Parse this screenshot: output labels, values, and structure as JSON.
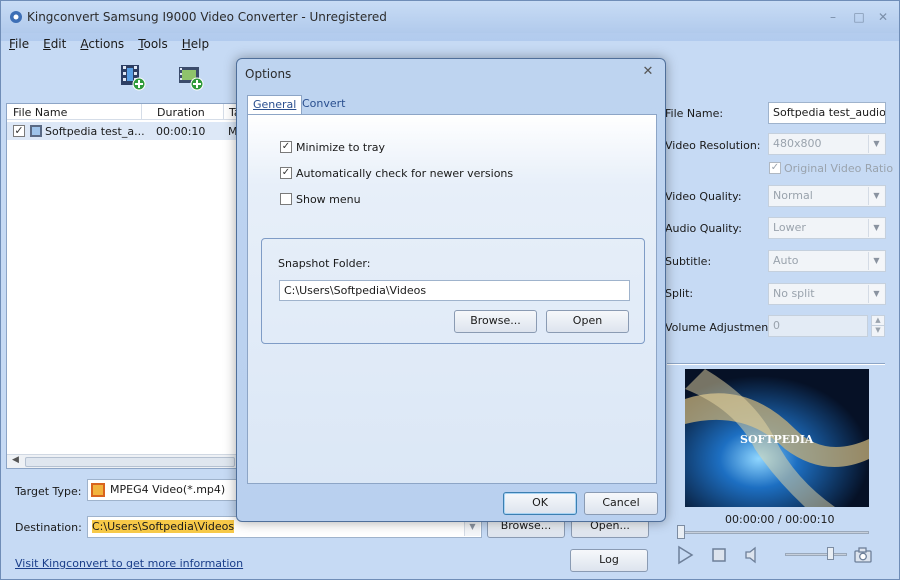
{
  "window": {
    "title": "Kingconvert Samsung I9000 Video Converter - Unregistered",
    "minimize": "–",
    "maximize": "□",
    "close": "✕"
  },
  "menu": [
    "File",
    "Edit",
    "Actions",
    "Tools",
    "Help"
  ],
  "filelist": {
    "columns": [
      "File Name",
      "Duration",
      "Ta"
    ],
    "rows": [
      {
        "name": "Softpedia test_a...",
        "duration": "00:00:10",
        "extra": "M"
      }
    ]
  },
  "bottom": {
    "target_type_label": "Target Type:",
    "target_type_value": "MPEG4 Video(*.mp4)",
    "destination_label": "Destination:",
    "destination_value": "C:\\Users\\Softpedia\\Videos",
    "browse_label": "Browse...",
    "open_label": "Open...",
    "link": "Visit Kingconvert to get more information",
    "log_label": "Log"
  },
  "right_panel": {
    "file_name_label": "File Name:",
    "file_name_value": "Softpedia test_audio_a",
    "video_resolution_label": "Video Resolution:",
    "video_resolution_value": "480x800",
    "original_ratio_label": "Original Video Ratio",
    "video_quality_label": "Video Quality:",
    "video_quality_value": "Normal",
    "audio_quality_label": "Audio Quality:",
    "audio_quality_value": "Lower",
    "subtitle_label": "Subtitle:",
    "subtitle_value": "Auto",
    "split_label": "Split:",
    "split_value": "No split",
    "volume_label": "Volume Adjustment:",
    "volume_value": "0",
    "time_readout": "00:00:00 / 00:00:10",
    "preview_watermark": "SOFTPEDIA"
  },
  "dialog": {
    "title": "Options",
    "tabs": [
      "General",
      "Convert"
    ],
    "checkboxes": [
      {
        "label": "Minimize to tray",
        "checked": true
      },
      {
        "label": "Automatically check for newer versions",
        "checked": true
      },
      {
        "label": "Show menu",
        "checked": false
      }
    ],
    "snapshot_label": "Snapshot Folder:",
    "snapshot_value": "C:\\Users\\Softpedia\\Videos",
    "browse_label": "Browse...",
    "open_label": "Open",
    "ok_label": "OK",
    "cancel_label": "Cancel"
  },
  "colors": {
    "window_bg": "#c6daf4",
    "accent": "#2a4f8f",
    "highlight": "#f7c948"
  }
}
